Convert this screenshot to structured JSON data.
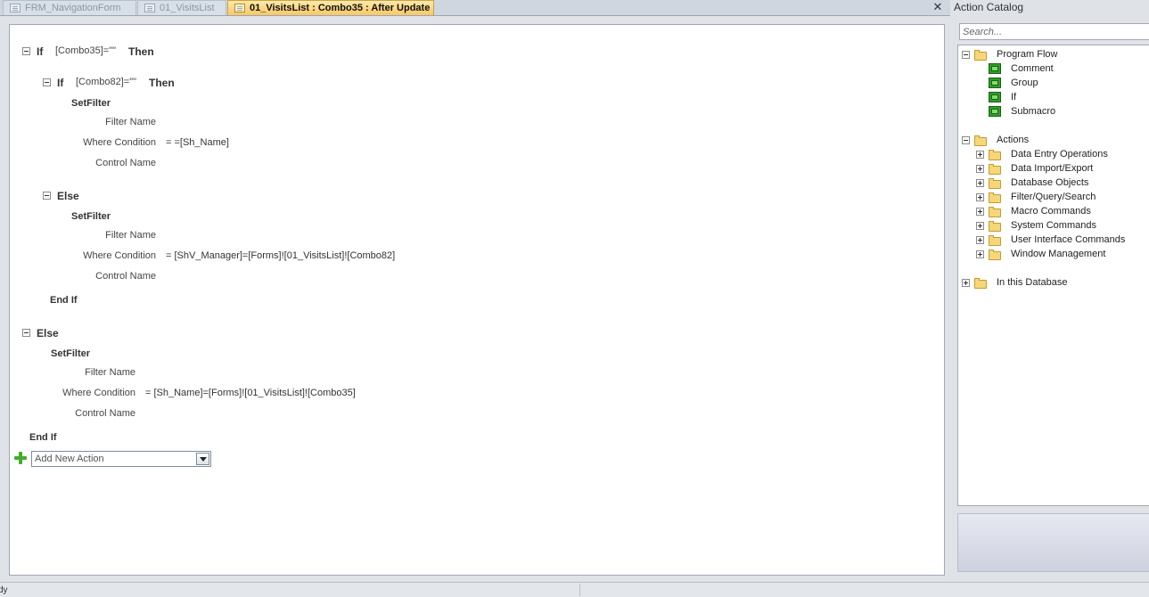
{
  "tabs": [
    {
      "label": "FRM_NavigationForm",
      "active": false
    },
    {
      "label": "01_VisitsList",
      "active": false
    },
    {
      "label": "01_VisitsList : Combo35 : After Update",
      "active": true
    }
  ],
  "close_glyph": "✕",
  "macro": {
    "if1": {
      "keyword": "If",
      "condition": "[Combo35]=\"\"",
      "then": "Then"
    },
    "if2": {
      "keyword": "If",
      "condition": "[Combo82]=\"\"",
      "then": "Then"
    },
    "setfilter1": {
      "name": "SetFilter",
      "filter_label": "Filter Name",
      "filter_value": "",
      "where_label": "Where Condition",
      "where_value": "= =[Sh_Name]",
      "control_label": "Control Name",
      "control_value": ""
    },
    "else2": "Else",
    "setfilter2": {
      "name": "SetFilter",
      "filter_label": "Filter Name",
      "filter_value": "",
      "where_label": "Where Condition",
      "where_value": "= [ShV_Manager]=[Forms]![01_VisitsList]![Combo82]",
      "control_label": "Control Name",
      "control_value": ""
    },
    "endif2": "End If",
    "else1": "Else",
    "setfilter3": {
      "name": "SetFilter",
      "filter_label": "Filter Name",
      "filter_value": "",
      "where_label": "Where Condition",
      "where_value": "= [Sh_Name]=[Forms]![01_VisitsList]![Combo35]",
      "control_label": "Control Name",
      "control_value": ""
    },
    "endif1": "End If",
    "add_action_placeholder": "Add New Action"
  },
  "catalog": {
    "title": "Action Catalog",
    "search_placeholder": "Search...",
    "program_flow": {
      "label": "Program Flow",
      "items": [
        "Comment",
        "Group",
        "If",
        "Submacro"
      ]
    },
    "actions": {
      "label": "Actions",
      "items": [
        "Data Entry Operations",
        "Data Import/Export",
        "Database Objects",
        "Filter/Query/Search",
        "Macro Commands",
        "System Commands",
        "User Interface Commands",
        "Window Management"
      ]
    },
    "in_this_database": "In this Database"
  },
  "status": {
    "text": "dy"
  },
  "colors": {
    "active_tab": "#f8c766",
    "add_icon": "#3fae2a",
    "flow_icon": "#2f9e2a",
    "folder": "#f5d77a"
  }
}
